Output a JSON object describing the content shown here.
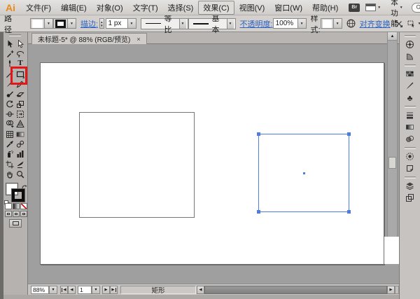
{
  "window": {
    "logo": "Ai",
    "controls": {
      "minimize": "–",
      "restore": "❐",
      "close": "×"
    }
  },
  "menu_bar": {
    "items": [
      "文件(F)",
      "编辑(E)",
      "对象(O)",
      "文字(T)",
      "选择(S)",
      "效果(C)",
      "视图(V)",
      "窗口(W)",
      "帮助(H)"
    ],
    "highlighted_item": "效果(C)",
    "bridge_icon_label": "Br",
    "workspace_switcher": "基本功能",
    "search_placeholder": ""
  },
  "control_bar": {
    "context_label": "路径",
    "stroke_label": "描边:",
    "stroke_weight": "1 px",
    "width_profile": "等比",
    "brush_definition": "基本",
    "opacity_label": "不透明度:",
    "opacity_value": "100%",
    "style_label": "样式:",
    "align_label": "对齐",
    "transform_label": "变换"
  },
  "document": {
    "tab_title": "未标题-5* @ 88% (RGB/预览)",
    "close_glyph": "×"
  },
  "toolbar": {
    "tools": [
      "selection",
      "direct-selection",
      "magic-wand",
      "lasso",
      "pen",
      "type",
      "line-segment",
      "rectangle",
      "paintbrush",
      "pencil",
      "blob-brush",
      "eraser",
      "rotate",
      "scale",
      "width",
      "free-transform",
      "shape-builder",
      "perspective-grid",
      "mesh",
      "gradient",
      "eyedropper",
      "blend",
      "symbol-sprayer",
      "column-graph",
      "artboard",
      "slice",
      "hand",
      "zoom"
    ],
    "active_tool": "rectangle",
    "type_tool_glyph": "T"
  },
  "panel_dock": {
    "icons": [
      "color",
      "color-guide",
      "swatches",
      "brushes",
      "symbols",
      "stroke",
      "gradient",
      "transparency",
      "appearance",
      "graphic-styles",
      "layers",
      "artboards"
    ],
    "symbols_glyph": "♣"
  },
  "canvas": {
    "objects": [
      {
        "type": "rectangle",
        "stroke": "black",
        "selected": false
      },
      {
        "type": "rectangle",
        "stroke": "black",
        "selected": true
      }
    ]
  },
  "status_bar": {
    "zoom_level": "88%",
    "page_number": "1",
    "status_text": "矩形"
  },
  "glyphs": {
    "dropdown": "▼",
    "up_arrow": "▲",
    "left_arrow": "◀",
    "right_arrow": "▶"
  },
  "colors": {
    "selection_blue": "#4d7ce2",
    "annotation_red": "#e51616",
    "link_blue": "#2b62c4",
    "logo_orange": "#e8891c"
  }
}
